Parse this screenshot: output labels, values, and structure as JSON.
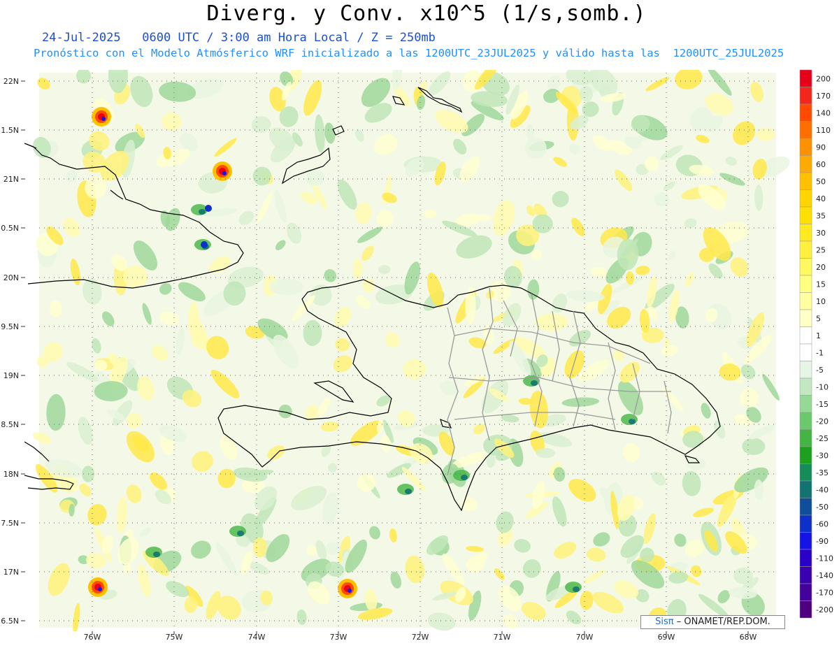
{
  "title": "Diverg. y Conv. x10^5 (1/s,somb.)",
  "subtitle_date": "24-Jul-2025   0600 UTC / 3:00 am Hora Local / Z = 250mb",
  "subtitle_model": "Pronóstico con el Modelo Atmósferico WRF inicializado a las 1200UTC_23JUL2025 y válido hasta las  1200UTC_25JUL2025",
  "lat_labels": [
    "22N",
    "1.5N",
    "21N",
    "0.5N",
    "20N",
    "9.5N",
    "19N",
    "8.5N",
    "18N",
    "7.5N",
    "17N",
    "6.5N"
  ],
  "lon_labels": [
    "76W",
    "75W",
    "74W",
    "73W",
    "72W",
    "71W",
    "70W",
    "69W",
    "68W"
  ],
  "colorbar": {
    "labels": [
      "200",
      "170",
      "140",
      "110",
      "90",
      "60",
      "50",
      "40",
      "35",
      "30",
      "25",
      "20",
      "15",
      "10",
      "5",
      "1",
      "-1",
      "-5",
      "-10",
      "-15",
      "-20",
      "-25",
      "-30",
      "-35",
      "-40",
      "-50",
      "-60",
      "-90",
      "-110",
      "-140",
      "-170",
      "-200"
    ],
    "colors": [
      "#e8001a",
      "#f2261a",
      "#ff4a00",
      "#ff6e00",
      "#ff9000",
      "#ffaa00",
      "#ffc000",
      "#ffd400",
      "#ffe000",
      "#ffea20",
      "#fff040",
      "#fff860",
      "#ffff80",
      "#ffffa0",
      "#ffffc8",
      "#ffffff",
      "#ffffff",
      "#e6f5e6",
      "#c2e8c2",
      "#96d896",
      "#6cc86c",
      "#44b444",
      "#1ea01e",
      "#178c5a",
      "#127370",
      "#0e4e9a",
      "#0c30c8",
      "#1414e6",
      "#2a00c8",
      "#3a00b0",
      "#44009a",
      "#4e0080"
    ]
  },
  "credit": {
    "brand": "Sisπ",
    "org": "– ONAMET/REP.DOM."
  },
  "map_colors": {
    "background": "#f0f8dc",
    "coast": "#000000",
    "provinces": "#9a9a9a"
  }
}
